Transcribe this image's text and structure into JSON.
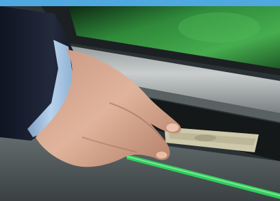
{
  "photo": {
    "subject": "atm-cash-withdrawal",
    "palette": {
      "top_band": "#4fa8df",
      "screen_green": "#3fa24a",
      "screen_dark": "#0f2a14",
      "bezel": "#24292b",
      "panel_silver": "#b9bdbe",
      "panel_shadow": "#6f7577",
      "sleeve_navy": "#1c2232",
      "cuff_blue": "#a9c9e6",
      "skin": "#d9ab92",
      "skin_shadow": "#a4705a",
      "banknote": "#c9c3a6",
      "slot_led": "#2fd05a"
    }
  }
}
